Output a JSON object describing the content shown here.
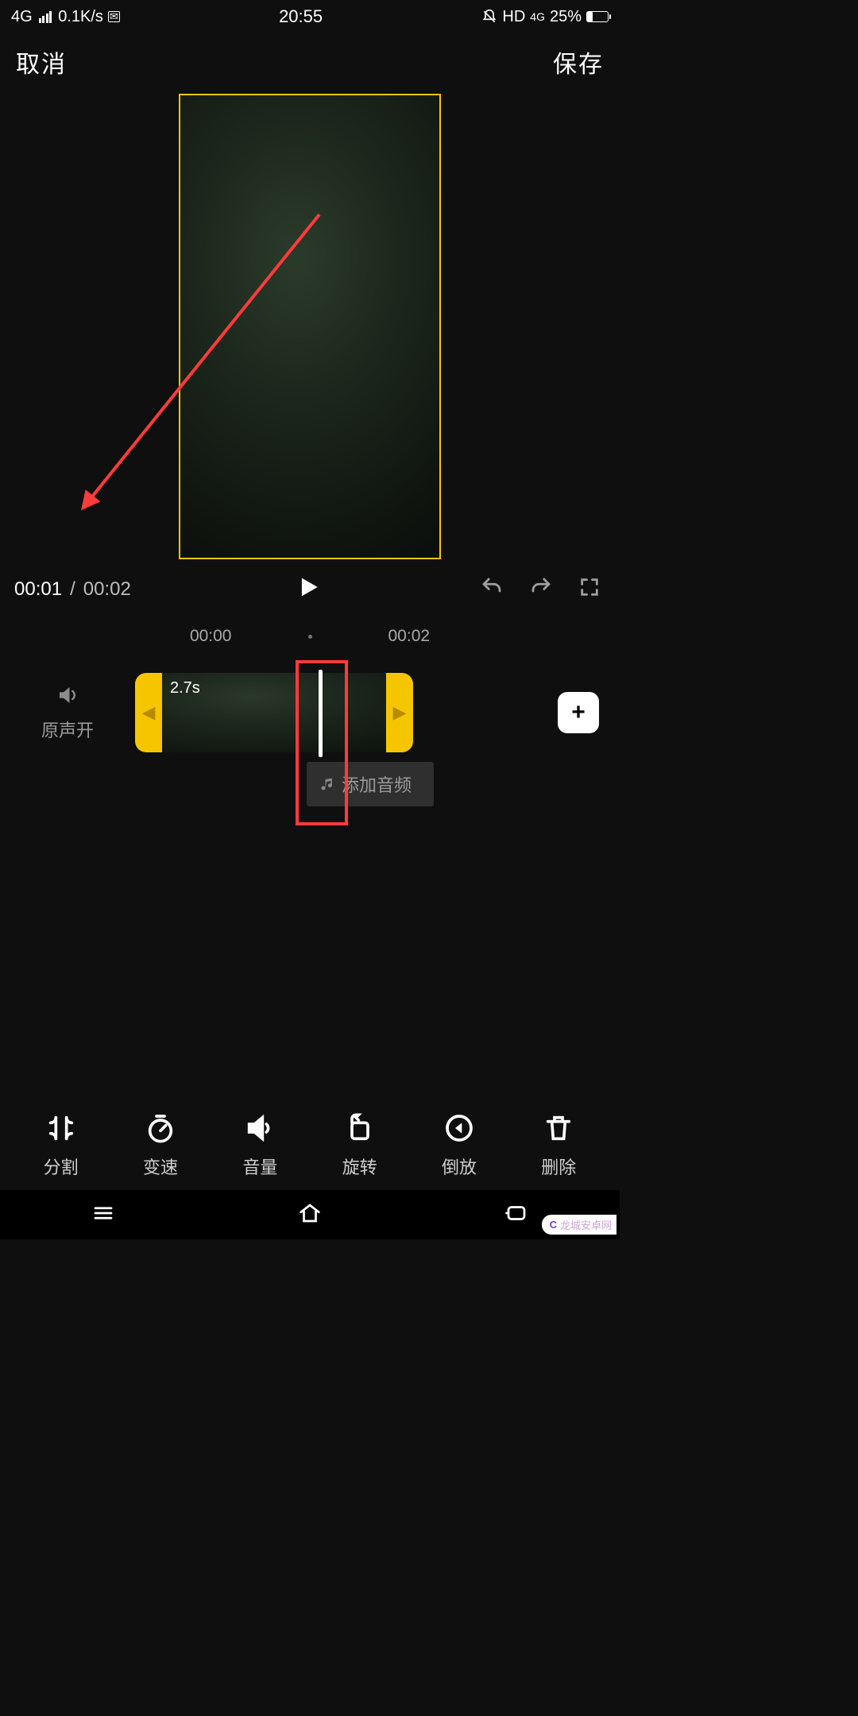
{
  "status": {
    "network": "4G",
    "speed": "0.1K/s",
    "time": "20:55",
    "hd": "HD",
    "net2": "4G",
    "battery_pct": "25%"
  },
  "header": {
    "cancel": "取消",
    "save": "保存"
  },
  "playback": {
    "current": "00:01",
    "sep": "/",
    "total": "00:02"
  },
  "timeline": {
    "tick_start": "00:00",
    "tick_end": "00:02",
    "sound_label": "原声开",
    "clip_duration": "2.7s",
    "add_audio": "添加音频"
  },
  "tools": {
    "split": "分割",
    "speed": "变速",
    "volume": "音量",
    "rotate": "旋转",
    "reverse": "倒放",
    "delete": "删除"
  },
  "watermark": "龙城安卓网"
}
